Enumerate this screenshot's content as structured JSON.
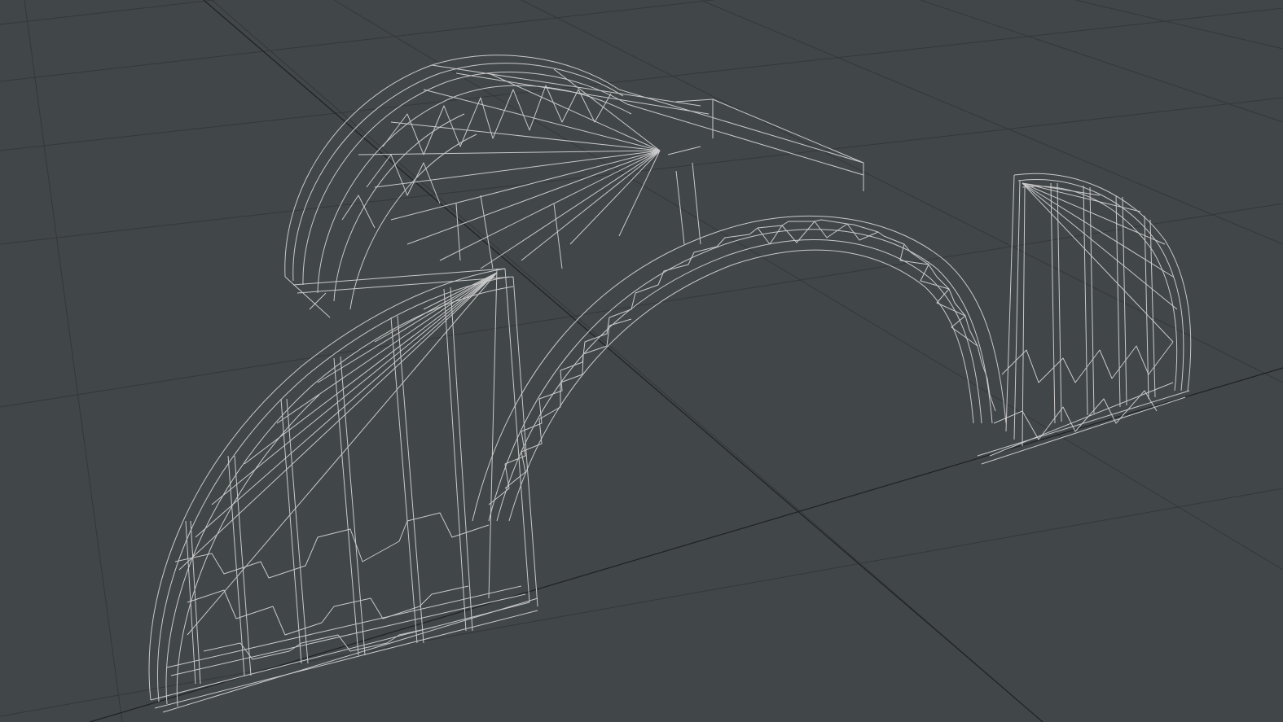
{
  "viewport": {
    "background_color": "#414649",
    "grid_color": "#34383b",
    "axis_color": "#1f2224",
    "wire_color": "#c9c9c9",
    "wire_dim_color": "#a9a9a9"
  },
  "scene": {
    "object": "wireframe-arch-truss-structure",
    "display_mode": "wireframe"
  }
}
